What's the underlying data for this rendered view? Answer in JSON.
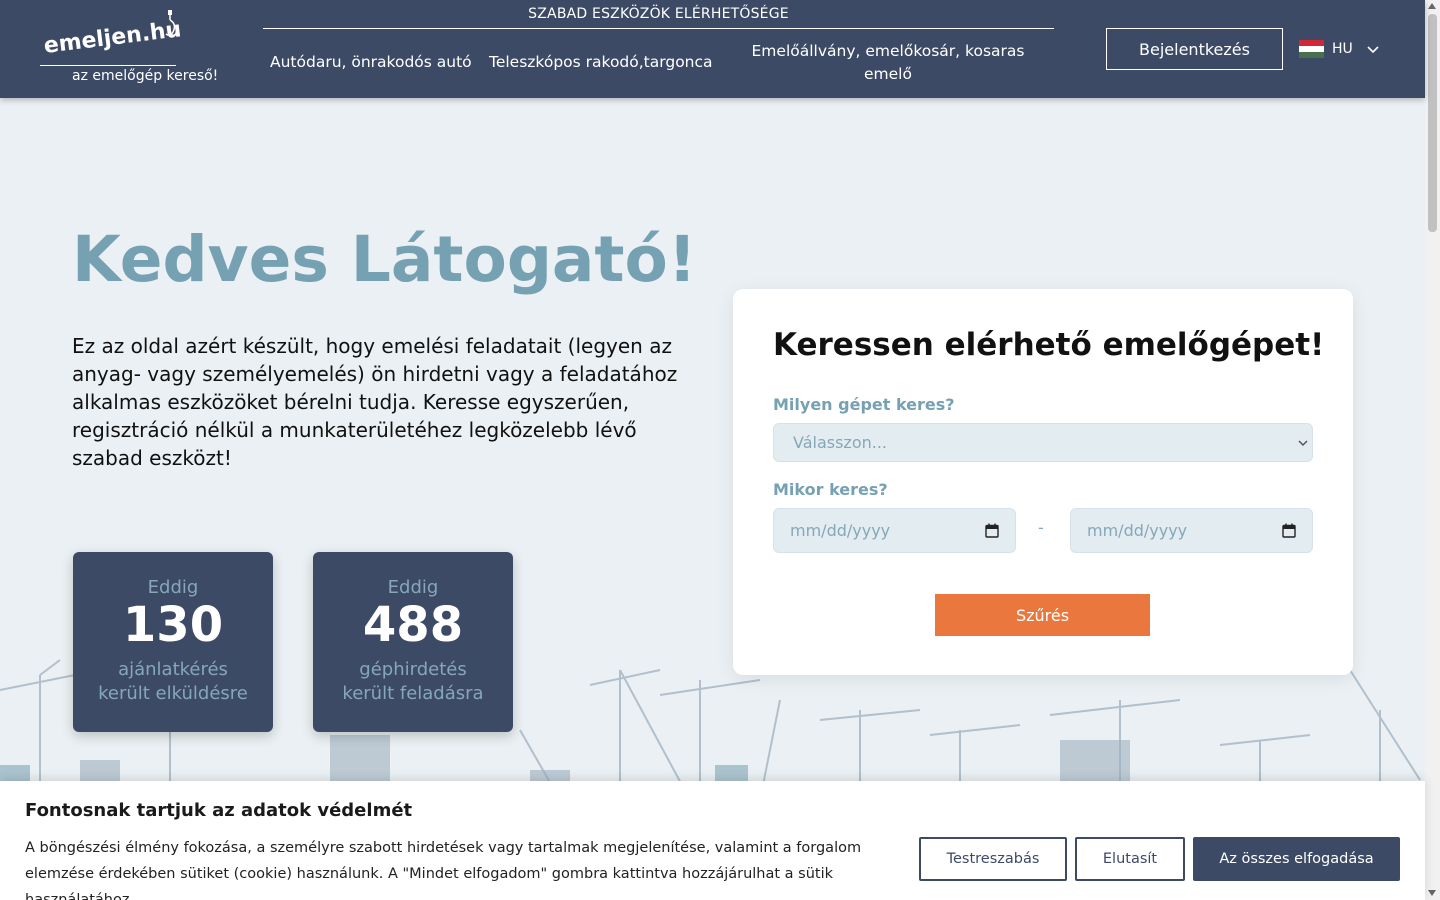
{
  "header": {
    "logo_text": "emeljen.hu",
    "logo_tagline": "az emelőgép kereső!",
    "nav_heading": "SZABAD ESZKÖZÖK ELÉRHETŐSÉGE",
    "nav_items": [
      {
        "label": "Autódaru, önrakodós autó"
      },
      {
        "label": "Teleszkópos rakodó,targonca"
      },
      {
        "label": "Emelőállvány, emelőkosár, kosaras emelő"
      }
    ],
    "login_label": "Bejelentkezés",
    "language": "HU"
  },
  "hero": {
    "title": "Kedves Látogató!",
    "text": "Ez az oldal azért készült, hogy emelési feladatait (legyen az anyag- vagy személyemelés) ön hirdetni vagy a feladatához alkalmas eszközöket bérelni tudja. Keresse egyszerűen, regisztráció nélkül a munkaterületéhez legközelebb lévő szabad eszközt!"
  },
  "stats": [
    {
      "prefix": "Eddig",
      "value": "130",
      "line1": "ajánlatkérés",
      "line2": "került elküldésre"
    },
    {
      "prefix": "Eddig",
      "value": "488",
      "line1": "géphirdetés",
      "line2": "került feladásra"
    }
  ],
  "search": {
    "title": "Keressen elérhető emelőgépet!",
    "machine_label": "Milyen gépet keres?",
    "machine_selected": "Válasszon...",
    "date_label": "Mikor keres?",
    "date_from_placeholder": "mm/dd/yyyy",
    "date_separator": "-",
    "date_to_placeholder": "mm/dd/yyyy",
    "filter_label": "Szűrés"
  },
  "cookie": {
    "title": "Fontosnak tartjuk az adatok védelmét",
    "text": "A böngészési élmény fokozása, a személyre szabott hirdetések vagy tartalmak megjelenítése, valamint a forgalom elemzése érdekében sütiket (cookie) használunk. A \"Mindet elfogadom\" gombra kattintva hozzájárulhat a sütik használatához.",
    "customize_label": "Testreszabás",
    "reject_label": "Elutasít",
    "accept_all_label": "Az összes elfogadása"
  },
  "colors": {
    "header_bg": "#3d4a66",
    "accent_light": "#76a1b3",
    "button_orange": "#ea773d",
    "page_bg": "#eaf0f3"
  }
}
